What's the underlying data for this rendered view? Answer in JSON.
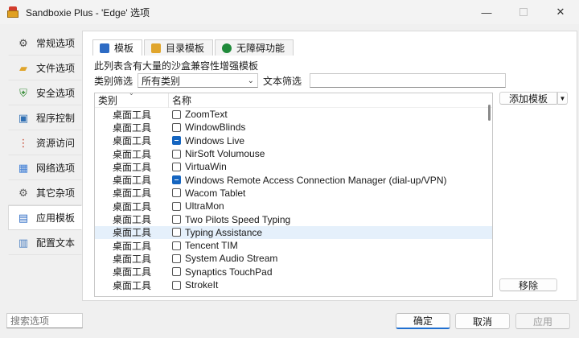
{
  "window": {
    "title": "Sandboxie Plus - 'Edge' 选项",
    "controls": {
      "minimize": "—",
      "close": "✕"
    }
  },
  "sidebar": {
    "items": [
      {
        "label": "常规选项",
        "icon": "gear-icon"
      },
      {
        "label": "文件选项",
        "icon": "folder-icon"
      },
      {
        "label": "安全选项",
        "icon": "shield-icon"
      },
      {
        "label": "程序控制",
        "icon": "program-icon"
      },
      {
        "label": "资源访问",
        "icon": "traffic-light-icon"
      },
      {
        "label": "网络选项",
        "icon": "network-icon"
      },
      {
        "label": "其它杂项",
        "icon": "misc-gears-icon"
      },
      {
        "label": "应用模板",
        "icon": "database-icon"
      },
      {
        "label": "配置文本",
        "icon": "notepad-icon"
      }
    ],
    "active_index": 7
  },
  "tabs": [
    {
      "label": "模板",
      "icon": "template-icon"
    },
    {
      "label": "目录模板",
      "icon": "folder-template-icon"
    },
    {
      "label": "无障碍功能",
      "icon": "accessibility-icon"
    }
  ],
  "main": {
    "description": "此列表含有大量的沙盒兼容性增强模板",
    "category_filter_label": "类别筛选",
    "category_filter_value": "所有类别",
    "text_filter_label": "文本筛选",
    "text_filter_value": ""
  },
  "list": {
    "columns": [
      "类别",
      "名称"
    ],
    "rows": [
      {
        "category": "桌面工具",
        "name": "ZoomText",
        "state": "unchecked"
      },
      {
        "category": "桌面工具",
        "name": "WindowBlinds",
        "state": "unchecked"
      },
      {
        "category": "桌面工具",
        "name": "Windows Live",
        "state": "partial"
      },
      {
        "category": "桌面工具",
        "name": "NirSoft Volumouse",
        "state": "unchecked"
      },
      {
        "category": "桌面工具",
        "name": "VirtuaWin",
        "state": "unchecked"
      },
      {
        "category": "桌面工具",
        "name": "Windows Remote Access Connection Manager (dial-up/VPN)",
        "state": "partial"
      },
      {
        "category": "桌面工具",
        "name": "Wacom Tablet",
        "state": "unchecked"
      },
      {
        "category": "桌面工具",
        "name": "UltraMon",
        "state": "unchecked"
      },
      {
        "category": "桌面工具",
        "name": "Two Pilots Speed Typing",
        "state": "unchecked"
      },
      {
        "category": "桌面工具",
        "name": "Typing Assistance",
        "state": "unchecked"
      },
      {
        "category": "桌面工具",
        "name": "Tencent TIM",
        "state": "unchecked"
      },
      {
        "category": "桌面工具",
        "name": "System Audio Stream",
        "state": "unchecked"
      },
      {
        "category": "桌面工具",
        "name": "Synaptics TouchPad",
        "state": "unchecked"
      },
      {
        "category": "桌面工具",
        "name": "StrokeIt",
        "state": "unchecked"
      }
    ],
    "highlighted_index": 9
  },
  "side_buttons": {
    "add_template": "添加模板",
    "remove": "移除"
  },
  "footer": {
    "search_placeholder": "搜索选项",
    "ok": "确定",
    "cancel": "取消",
    "apply": "应用"
  }
}
